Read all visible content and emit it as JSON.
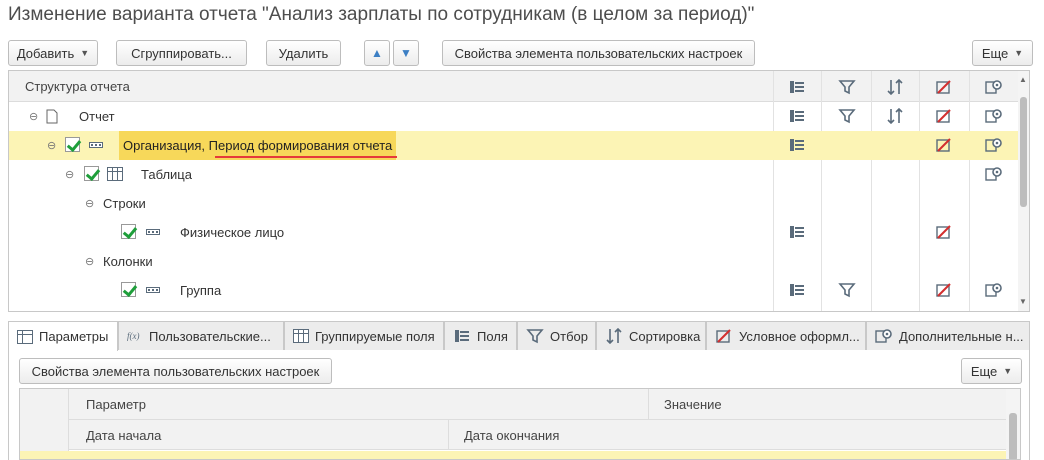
{
  "window": {
    "title": "Изменение варианта отчета \"Анализ зарплаты по сотрудникам (в целом за период)\""
  },
  "toolbar": {
    "add_label": "Добавить",
    "group_label": "Сгруппировать...",
    "delete_label": "Удалить",
    "move_up_icon": "arrow-up-icon",
    "move_down_icon": "arrow-down-icon",
    "props_label": "Свойства элемента пользовательских настроек",
    "more_label": "Еще"
  },
  "tree": {
    "header": "Структура отчета",
    "column_icons": [
      "fields-icon",
      "filter-icon",
      "sort-icon",
      "conditional-format-icon",
      "additional-settings-icon"
    ],
    "rows": [
      {
        "label": "Отчет",
        "checked": false,
        "selected": false,
        "icons": [
          "fields-icon",
          "filter-icon",
          "sort-icon",
          "conditional-format-icon",
          "additional-settings-icon"
        ]
      },
      {
        "label_part1": "Организация, ",
        "label_part2": "Период формирования отчета",
        "checked": true,
        "selected": true,
        "icons": [
          "fields-icon",
          "conditional-format-icon",
          "additional-settings-icon"
        ]
      },
      {
        "label": "Таблица",
        "checked": true,
        "selected": false,
        "icons": [
          "additional-settings-icon"
        ]
      },
      {
        "label": "Строки",
        "checked": false,
        "selected": false,
        "icons": []
      },
      {
        "label": "Физическое лицо",
        "checked": true,
        "selected": false,
        "icons": [
          "fields-icon",
          "conditional-format-icon"
        ]
      },
      {
        "label": "Колонки",
        "checked": false,
        "selected": false,
        "icons": []
      },
      {
        "label": "Группа",
        "checked": true,
        "selected": false,
        "icons": [
          "fields-icon",
          "filter-icon",
          "conditional-format-icon",
          "additional-settings-icon"
        ]
      }
    ]
  },
  "tabs": [
    {
      "label": "Параметры",
      "active": true
    },
    {
      "label": "Пользовательские...",
      "active": false
    },
    {
      "label": "Группируемые поля",
      "active": false
    },
    {
      "label": "Поля",
      "active": false
    },
    {
      "label": "Отбор",
      "active": false
    },
    {
      "label": "Сортировка",
      "active": false
    },
    {
      "label": "Условное оформл...",
      "active": false
    },
    {
      "label": "Дополнительные н...",
      "active": false
    }
  ],
  "params": {
    "props_label": "Свойства элемента пользовательских настроек",
    "more_label": "Еще",
    "col_param": "Параметр",
    "col_value": "Значение",
    "col_start": "Дата начала",
    "col_end": "Дата окончания"
  },
  "colors": {
    "selection": "#fcf4b5",
    "check": "#1e9e3a",
    "underline": "#e53a3a",
    "arrow": "#3c7fc4"
  }
}
